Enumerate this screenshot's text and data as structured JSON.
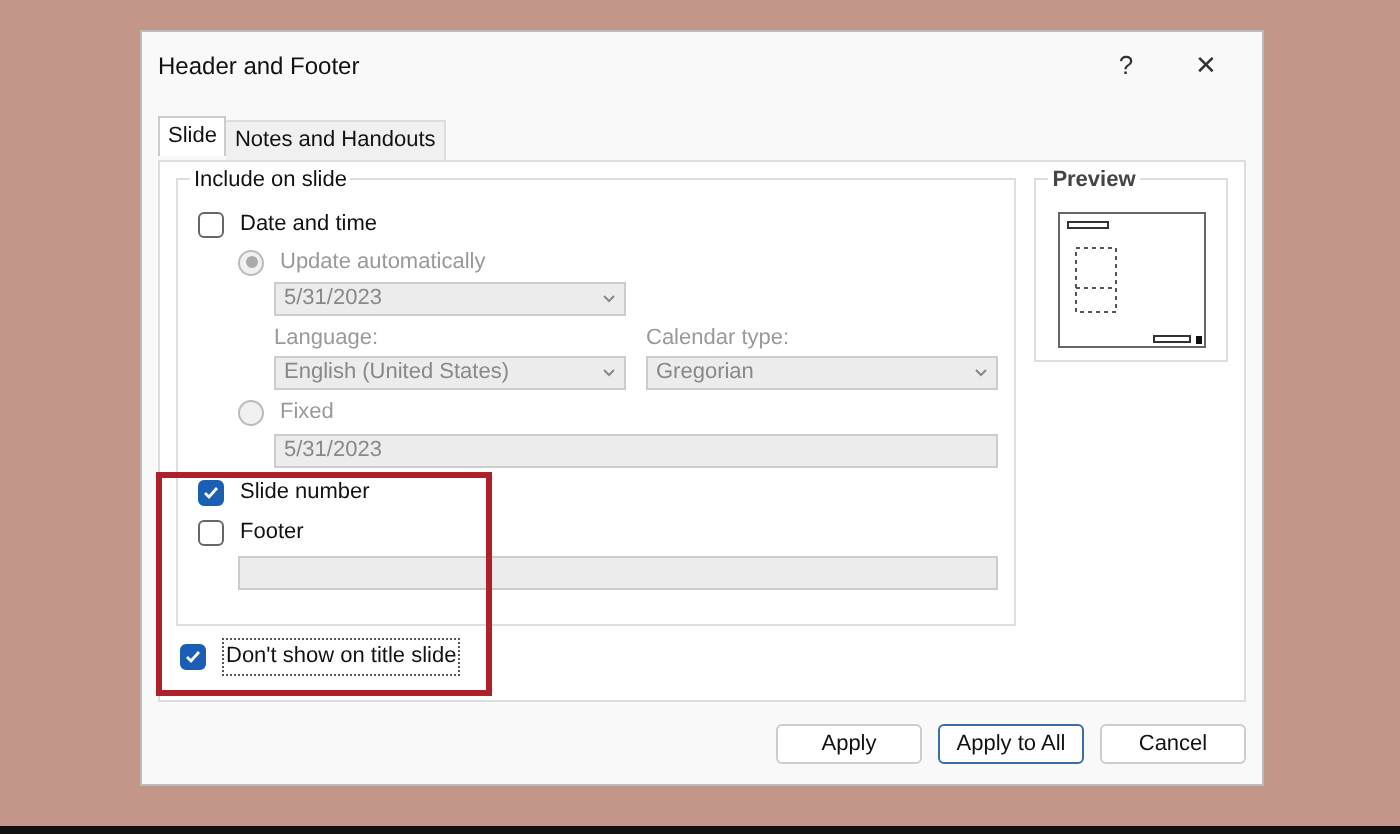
{
  "window": {
    "title": "Header and Footer",
    "help": "?",
    "close": "✕"
  },
  "tabs": [
    {
      "label": "Slide",
      "selected": true
    },
    {
      "label": "Notes and Handouts",
      "selected": false
    }
  ],
  "group": {
    "title": "Include on slide",
    "date_time": {
      "label": "Date and time",
      "checked": false
    },
    "update_auto": {
      "label": "Update automatically",
      "selected": true,
      "disabled": true,
      "value": "5/31/2023"
    },
    "language": {
      "label": "Language:",
      "value": "English (United States)",
      "disabled": true
    },
    "calendar": {
      "label": "Calendar type:",
      "value": "Gregorian",
      "disabled": true
    },
    "fixed": {
      "label": "Fixed",
      "selected": false,
      "disabled": true,
      "value": "5/31/2023"
    },
    "slide_number": {
      "label": "Slide number",
      "checked": true
    },
    "footer": {
      "label": "Footer",
      "checked": false
    }
  },
  "dont_show": {
    "label": "Don't show on title slide",
    "checked": true
  },
  "preview": {
    "title": "Preview"
  },
  "buttons": [
    {
      "label": "Apply",
      "default": false
    },
    {
      "label": "Apply to All",
      "default": true
    },
    {
      "label": "Cancel",
      "default": false
    }
  ]
}
